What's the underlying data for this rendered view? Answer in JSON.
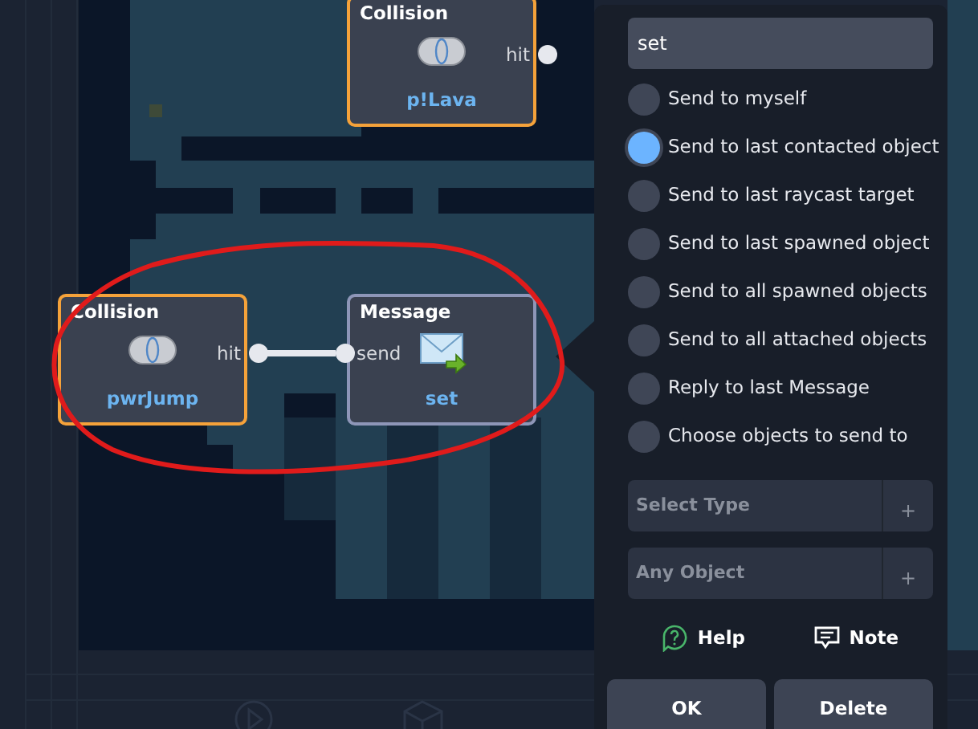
{
  "nodes": [
    {
      "kind": "collision",
      "title": "Collision",
      "label": "p!Lava",
      "port": "hit"
    },
    {
      "kind": "collision",
      "title": "Collision",
      "label": "pwrJump",
      "port": "hit"
    },
    {
      "kind": "message",
      "title": "Message",
      "label": "set",
      "port": "send"
    }
  ],
  "panel": {
    "message_field": {
      "value": "set"
    },
    "options": [
      {
        "label": "Send to myself",
        "selected": false
      },
      {
        "label": "Send to last contacted object",
        "selected": true
      },
      {
        "label": "Send to last raycast target",
        "selected": false
      },
      {
        "label": "Send to last spawned object",
        "selected": false
      },
      {
        "label": "Send to all spawned objects",
        "selected": false
      },
      {
        "label": "Send to all attached objects",
        "selected": false
      },
      {
        "label": "Reply to last Message",
        "selected": false
      },
      {
        "label": "Choose objects to send to",
        "selected": false
      }
    ],
    "pickers": [
      {
        "placeholder": "Select Type",
        "button": "+"
      },
      {
        "placeholder": "Any Object",
        "button": "+"
      }
    ],
    "links": [
      {
        "kind": "help",
        "label": "Help"
      },
      {
        "kind": "note",
        "label": "Note"
      }
    ],
    "buttons": [
      "OK",
      "Delete"
    ]
  }
}
